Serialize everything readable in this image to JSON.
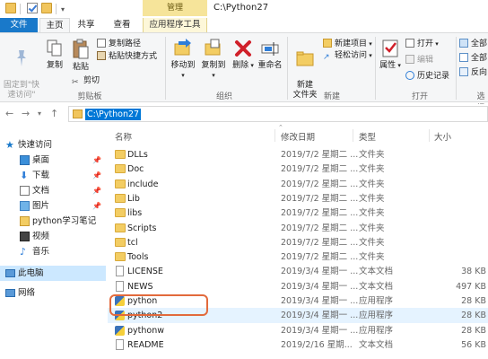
{
  "window": {
    "title": "C:\\Python27",
    "manage_tab": "管理"
  },
  "tabs": {
    "file": "文件",
    "home": "主页",
    "share": "共享",
    "view": "查看",
    "app_tools": "应用程序工具"
  },
  "ribbon": {
    "pin_quick": "固定到\"快\n速访问\"",
    "copy": "复制",
    "paste": "粘贴",
    "copy_path": "复制路径",
    "paste_shortcut": "粘贴快捷方式",
    "cut": "剪切",
    "clipboard_group": "剪贴板",
    "move_to": "移动到",
    "copy_to": "复制到",
    "delete": "删除",
    "rename": "重命名",
    "organize_group": "组织",
    "new_folder": "新建\n文件夹",
    "new_item": "新建项目",
    "easy_access": "轻松访问",
    "new_group": "新建",
    "properties": "属性",
    "open": "打开",
    "edit": "编辑",
    "history": "历史记录",
    "open_group": "打开",
    "select_all": "全部",
    "select_none": "全部",
    "invert": "反向",
    "select_group": "选择"
  },
  "address": {
    "path": "C:\\Python27"
  },
  "nav": {
    "quick_access": "快速访问",
    "items": [
      {
        "label": "桌面",
        "icon": "desktop-icon",
        "pinned": true
      },
      {
        "label": "下载",
        "icon": "download-icon",
        "pinned": true
      },
      {
        "label": "文档",
        "icon": "document-icon",
        "pinned": true
      },
      {
        "label": "图片",
        "icon": "picture-icon",
        "pinned": true
      },
      {
        "label": "python学习笔记",
        "icon": "folder-icon",
        "pinned": false
      },
      {
        "label": "视频",
        "icon": "video-icon",
        "pinned": false
      },
      {
        "label": "音乐",
        "icon": "music-icon",
        "pinned": false
      }
    ],
    "this_pc": "此电脑",
    "network": "网络"
  },
  "columns": {
    "name": "名称",
    "modified": "修改日期",
    "type": "类型",
    "size": "大小"
  },
  "files": [
    {
      "name": "DLLs",
      "date": "2019/7/2 星期二 ...",
      "type": "文件夹",
      "size": "",
      "kind": "folder"
    },
    {
      "name": "Doc",
      "date": "2019/7/2 星期二 ...",
      "type": "文件夹",
      "size": "",
      "kind": "folder"
    },
    {
      "name": "include",
      "date": "2019/7/2 星期二 ...",
      "type": "文件夹",
      "size": "",
      "kind": "folder"
    },
    {
      "name": "Lib",
      "date": "2019/7/2 星期二 ...",
      "type": "文件夹",
      "size": "",
      "kind": "folder"
    },
    {
      "name": "libs",
      "date": "2019/7/2 星期二 ...",
      "type": "文件夹",
      "size": "",
      "kind": "folder"
    },
    {
      "name": "Scripts",
      "date": "2019/7/2 星期二 ...",
      "type": "文件夹",
      "size": "",
      "kind": "folder"
    },
    {
      "name": "tcl",
      "date": "2019/7/2 星期二 ...",
      "type": "文件夹",
      "size": "",
      "kind": "folder"
    },
    {
      "name": "Tools",
      "date": "2019/7/2 星期二 ...",
      "type": "文件夹",
      "size": "",
      "kind": "folder"
    },
    {
      "name": "LICENSE",
      "date": "2019/3/4 星期一 ...",
      "type": "文本文档",
      "size": "38 KB",
      "kind": "doc"
    },
    {
      "name": "NEWS",
      "date": "2019/3/4 星期一 ...",
      "type": "文本文档",
      "size": "497 KB",
      "kind": "doc"
    },
    {
      "name": "python",
      "date": "2019/3/4 星期一 ...",
      "type": "应用程序",
      "size": "28 KB",
      "kind": "py"
    },
    {
      "name": "python2",
      "date": "2019/3/4 星期一 ...",
      "type": "应用程序",
      "size": "28 KB",
      "kind": "py"
    },
    {
      "name": "pythonw",
      "date": "2019/3/4 星期一 ...",
      "type": "应用程序",
      "size": "28 KB",
      "kind": "py"
    },
    {
      "name": "README",
      "date": "2019/2/16 星期...",
      "type": "文本文档",
      "size": "56 KB",
      "kind": "doc"
    }
  ],
  "colors": {
    "accent": "#1979ca",
    "selection": "#0078d7",
    "highlight_box": "#e26a3c",
    "manage_tab": "#f6e49a"
  }
}
